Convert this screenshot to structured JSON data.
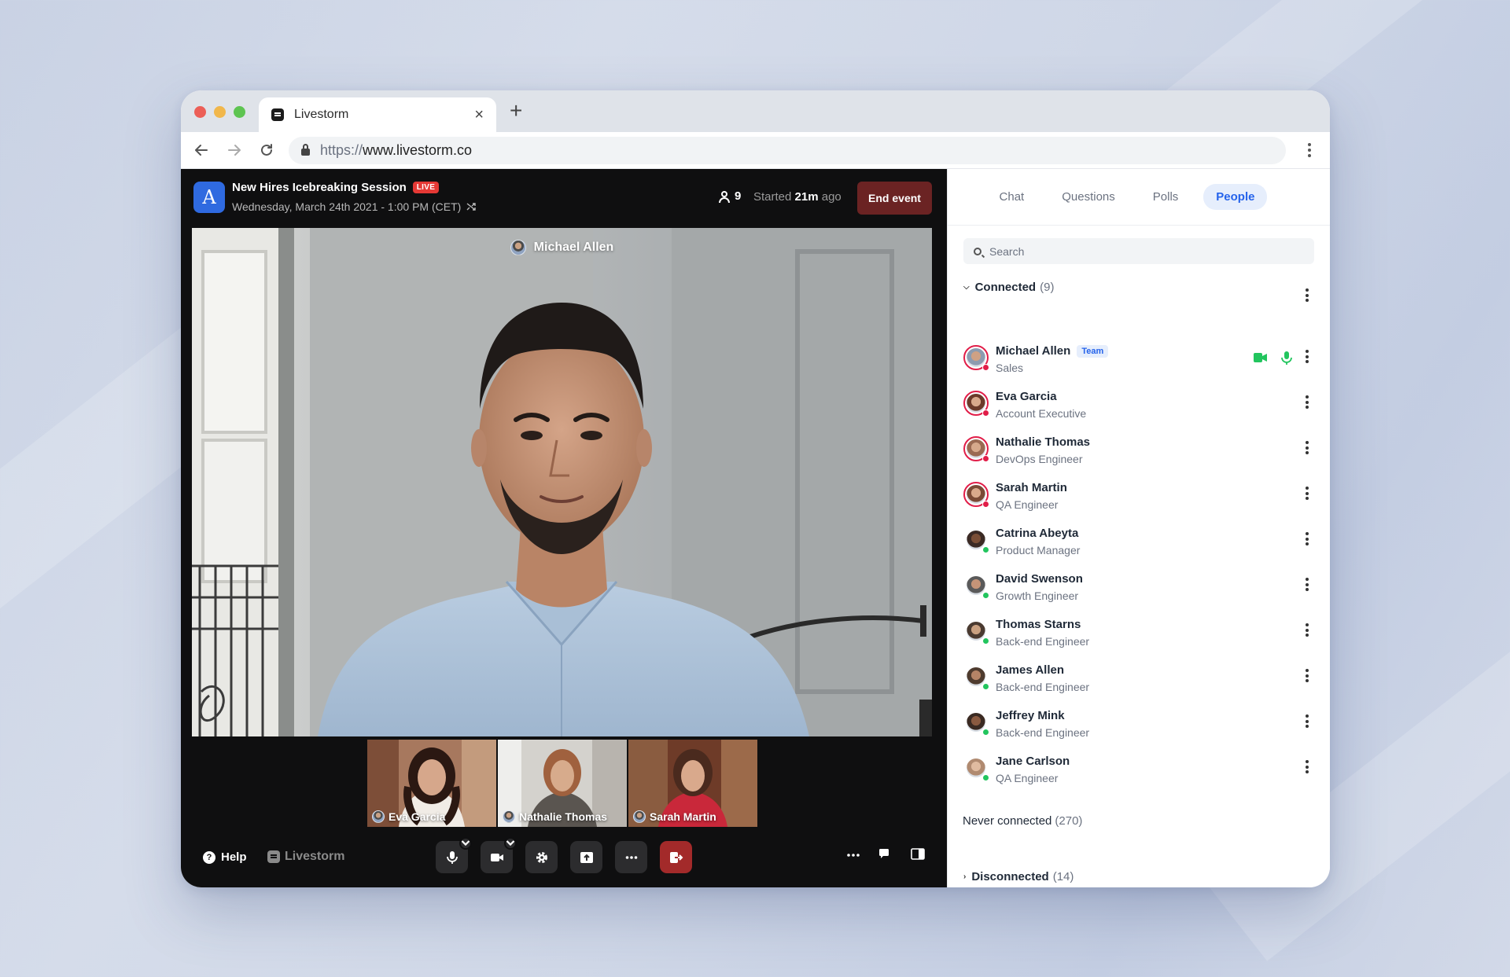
{
  "browser": {
    "tab_title": "Livestorm",
    "url_protocol": "https://",
    "url_host": "www.livestorm.co"
  },
  "event": {
    "title": "New Hires Icebreaking Session",
    "live_badge": "LIVE",
    "date": "Wednesday, March 24th 2021 - 1:00 PM (CET)",
    "attendee_count": "9",
    "started_prefix": "Started",
    "started_value": "21m",
    "started_suffix": "ago",
    "end_button": "End event",
    "logo_letter": "A"
  },
  "stage": {
    "speaker_name": "Michael Allen",
    "thumbnails": [
      {
        "name": "Eva Garcia"
      },
      {
        "name": "Nathalie Thomas"
      },
      {
        "name": "Sarah Martin"
      }
    ]
  },
  "footer": {
    "help_label": "Help",
    "brand_label": "Livestorm"
  },
  "panel": {
    "tabs": [
      {
        "label": "Chat",
        "active": false
      },
      {
        "label": "Questions",
        "active": false
      },
      {
        "label": "Polls",
        "active": false
      },
      {
        "label": "People",
        "active": true
      }
    ],
    "search_placeholder": "Search",
    "connected_label": "Connected",
    "connected_count": "(9)",
    "disconnected_label": "Disconnected",
    "disconnected_count": "(14)",
    "never_label": "Never connected",
    "never_count": "(270)",
    "people": [
      {
        "name": "Michael Allen",
        "role": "Sales",
        "badge": "Team",
        "status": "red"
      },
      {
        "name": "Eva Garcia",
        "role": "Account Executive",
        "status": "red"
      },
      {
        "name": "Nathalie Thomas",
        "role": "DevOps Engineer",
        "status": "red"
      },
      {
        "name": "Sarah Martin",
        "role": "QA Engineer",
        "status": "red"
      },
      {
        "name": "Catrina Abeyta",
        "role": "Product Manager",
        "status": "green"
      },
      {
        "name": "David Swenson",
        "role": "Growth Engineer",
        "status": "green"
      },
      {
        "name": "Thomas Starns",
        "role": "Back-end Engineer",
        "status": "green"
      },
      {
        "name": "James Allen",
        "role": "Back-end Engineer",
        "status": "green"
      },
      {
        "name": "Jeffrey Mink",
        "role": "Back-end Engineer",
        "status": "green"
      },
      {
        "name": "Jane Carlson",
        "role": "QA Engineer",
        "status": "green"
      }
    ]
  },
  "colors": {
    "accent": "#2563eb",
    "live_red": "#e53935",
    "end_button": "#6b2323",
    "status_online": "#22c55e",
    "status_speaking": "#e11d48"
  }
}
